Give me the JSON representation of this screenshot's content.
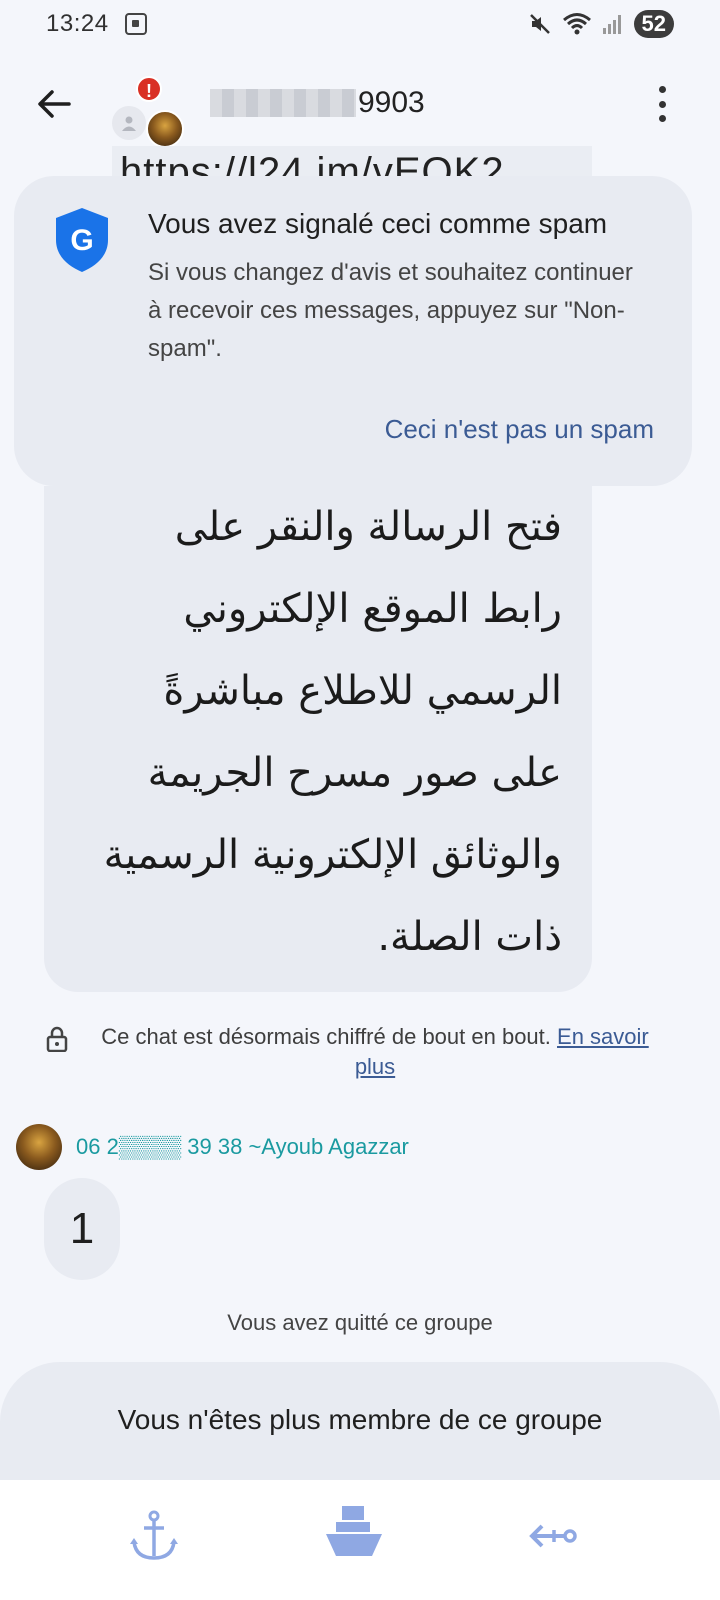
{
  "status_bar": {
    "time": "13:24",
    "battery": "52"
  },
  "header": {
    "contact_title_suffix": "9903",
    "alert_badge": "!"
  },
  "background_url_fragment": "https://l24.im/vEOK2",
  "spam_card": {
    "title": "Vous avez signalé ceci comme spam",
    "description": "Si vous changez d'avis et souhaitez continuer à recevoir ces messages, appuyez sur \"Non-spam\".",
    "not_spam_button": "Ceci n'est pas un spam",
    "shield_letter": "G"
  },
  "message": {
    "arabic_lines": [
      "فتح الرسالة والنقر على",
      "رابط الموقع الإلكتروني",
      "الرسمي للاطلاع مباشرةً",
      "على صور مسرح الجريمة",
      "والوثائق الإلكترونية الرسمية",
      "ذات الصلة."
    ]
  },
  "encryption": {
    "text": "Ce chat est désormais chiffré de bout en bout.",
    "link": "En savoir plus"
  },
  "sender": {
    "name": "06 2▒▒▒▒ 39 38 ~Ayoub Agazzar",
    "message": "1"
  },
  "system": {
    "left_group": "Vous avez quitté ce groupe",
    "not_member": "Vous n'êtes plus membre de ce groupe"
  },
  "colors": {
    "accent_link": "#3b5b94",
    "sender_name": "#1a9aa0",
    "alert": "#d93025",
    "nav_icon": "#8fa8e3"
  },
  "bottom_nav": {
    "icons": [
      "anchor-icon",
      "ship-icon",
      "arrow-back-icon"
    ]
  }
}
